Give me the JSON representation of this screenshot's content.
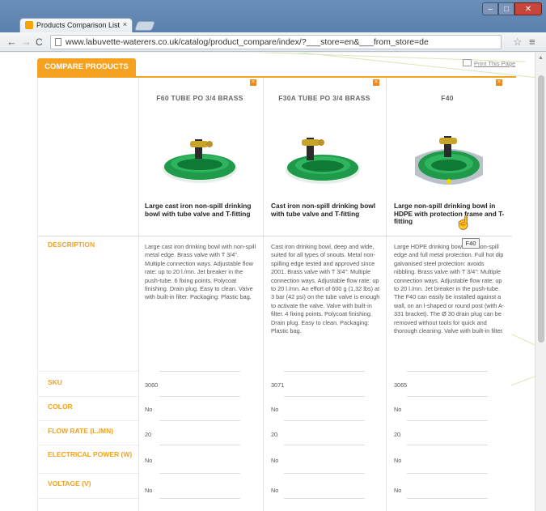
{
  "browser": {
    "tab_title": "Products Comparison List",
    "tab_close": "×",
    "url": "www.labuvette-waterers.co.uk/catalog/product_compare/index/?___store=en&___from_store=de",
    "win_min": "–",
    "win_max": "□",
    "win_close": "✕"
  },
  "page": {
    "compare_tab": "COMPARE PRODUCTS",
    "print_link": "Print This Page",
    "remove_label": "×",
    "tooltip": "F40",
    "products": [
      {
        "name": "F60 TUBE PO 3/4 BRASS",
        "title": "Large cast iron non-spill drinking bowl with tube valve and T-fitting",
        "description": "Large cast iron drinking bowl with non-spill metal edge. Brass valve with T 3/4\". Multiple connection ways. Adjustable flow rate: up to 20 l./mn. Jet breaker in the push-tube. 6 fixing points. Polycoat finishing. Drain plug. Easy to clean. Valve with built-in filter. Packaging: Plastic bag.",
        "sku": "3060",
        "color": "No",
        "flow_rate": "20",
        "electrical_power": "No",
        "voltage": "No"
      },
      {
        "name": "F30A TUBE PO 3/4 BRASS",
        "title": "Cast iron non-spill drinking bowl with tube valve and T-fitting",
        "description": "Cast iron drinking bowl, deep and wide, suited for all types of snouts. Metal non-spilling edge tested and approved since 2001. Brass valve with T 3/4\": Multiple connection ways. Adjustable flow rate: up to 20 l./mn. An effort of 600 g (1,32 lbs) at 3 bar (42 psi) on the tube valve is enough to activate the valve. Valve with built-in filter. 4 fixing points. Polycoat finishing. Drain plug. Easy to clean. Packaging: Plastic bag.",
        "sku": "3071",
        "color": "No",
        "flow_rate": "20",
        "electrical_power": "No",
        "voltage": "No"
      },
      {
        "name": "F40",
        "title": "Large non-spill drinking bowl in HDPE with protection frame and T-fitting",
        "description": "Large HDPE drinking bowl with non-spill edge and full metal protection. Full hot dip galvanised steel protection: avoids nibbling. Brass valve with T 3/4\": Multiple connection ways. Adjustable flow rate: up to 20 l./mn. Jet breaker in the push-tube. The F40 can easily be installed against a wall, on an l-shaped or round post (with A-331 bracket). The Ø 30 drain plug can be removed without tools for quick and thorough cleaning. Valve with built-in filter.",
        "sku": "3065",
        "color": "No",
        "flow_rate": "20",
        "electrical_power": "No",
        "voltage": "No"
      }
    ],
    "attributes": {
      "description": "DESCRIPTION",
      "sku": "SKU",
      "color": "COLOR",
      "flow_rate": "FLOW RATE (L./MN)",
      "electrical_power": "ELECTRICAL POWER (W)",
      "voltage": "VOLTAGE (V)"
    }
  },
  "colors": {
    "accent": "#f4a21f",
    "bowl_green": "#1e9a4a",
    "frame_gray": "#b8c2c8"
  }
}
